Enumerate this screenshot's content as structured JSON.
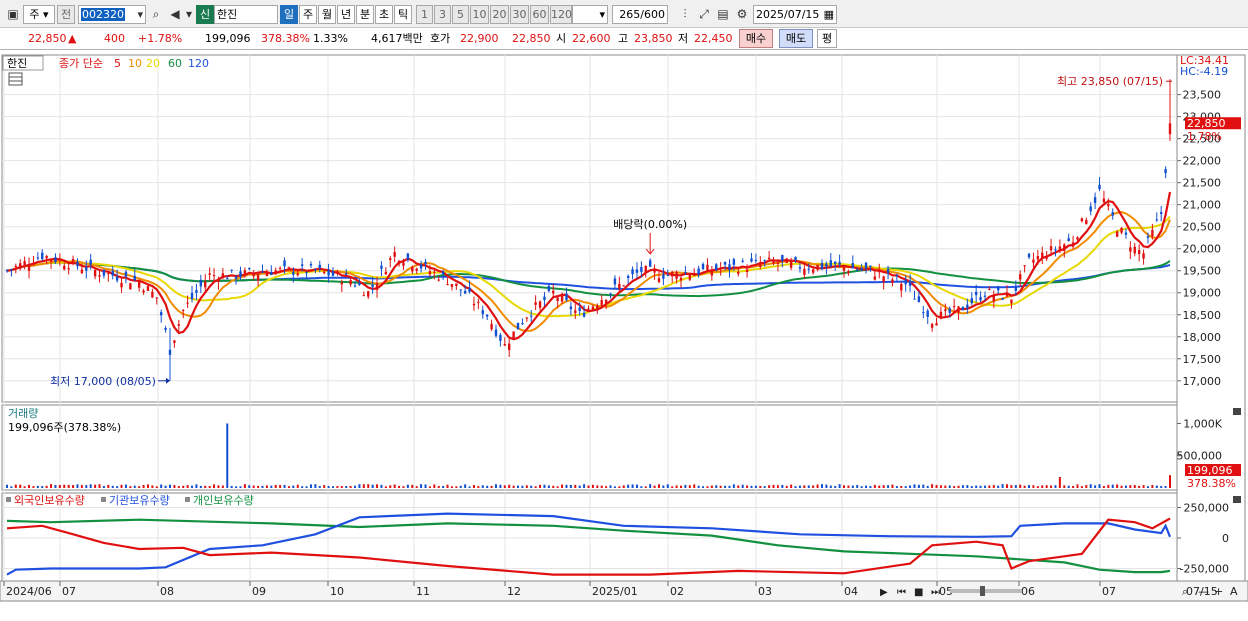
{
  "toolbar": {
    "market": "주",
    "prev": "전",
    "code": "002320",
    "new_badge": "신",
    "name": "한진",
    "periods": [
      "일",
      "주",
      "월",
      "년",
      "분",
      "초",
      "틱"
    ],
    "active_period": "일",
    "intervals": [
      "1",
      "3",
      "5",
      "10",
      "20",
      "30",
      "60",
      "120"
    ],
    "count": "265",
    "count_total": "/600",
    "date": "2025/07/15"
  },
  "quote": {
    "price": "22,850",
    "change": "400",
    "change_pct": "+1.78%",
    "volume": "199,096",
    "volume_ratio": "378.38%",
    "turnover_pct": "1.33%",
    "amount": "4,617백만",
    "label_ask": "호가",
    "ask": "22,900",
    "bid": "22,850",
    "label_open": "시",
    "open": "22,600",
    "label_high": "고",
    "high": "23,850",
    "label_low": "저",
    "low": "22,450",
    "buy_label": "매수",
    "sell_label": "매도",
    "eval_label": "평"
  },
  "price_panel": {
    "stock_tab": "한진",
    "ma_title": "종가 단순",
    "ma_periods": [
      "5",
      "10",
      "20",
      "60",
      "120"
    ],
    "ma_colors": [
      "#e01010",
      "#f08c00",
      "#e8d800",
      "#129040",
      "#2050e0"
    ],
    "lc": "LC:34.41",
    "hc": "HC:-4.19",
    "y_ticks": [
      "23,500",
      "23,000",
      "22,500",
      "22,000",
      "21,500",
      "21,000",
      "20,500",
      "20,000",
      "19,500",
      "19,000",
      "18,500",
      "18,000",
      "17,500",
      "17,000"
    ],
    "last_price": "22,850",
    "last_pct": "1.78%",
    "high_label": "최고 23,850 (07/15)",
    "low_label": "최저 17,000 (08/05)",
    "event_label": "배당락(0.00%)"
  },
  "volume_panel": {
    "title": "거래량",
    "summary": "199,096주(378.38%)",
    "y_ticks": [
      "1,000K",
      "500,000"
    ],
    "last": "199,096",
    "last_pct": "378.38%"
  },
  "holdings_panel": {
    "series": [
      "외국인보유수량",
      "기관보유수량",
      "개인보유수량"
    ],
    "colors": [
      "#e01010",
      "#2050e0",
      "#129040"
    ],
    "y_ticks": [
      "250,000",
      "0",
      "-250,000"
    ]
  },
  "x_axis": {
    "labels": [
      "2024/06",
      "07",
      "08",
      "09",
      "10",
      "11",
      "12",
      "2025/01",
      "02",
      "03",
      "04",
      "05",
      "06",
      "07"
    ],
    "right_label": "07/15"
  },
  "chart_data": {
    "type": "candlestick",
    "x_range": [
      "2024/06",
      "2025/07/15"
    ],
    "ylim": [
      17000,
      23850
    ],
    "high": 23850,
    "low": 17000,
    "last": 22850,
    "moving_averages": [
      "5",
      "10",
      "20",
      "60",
      "120"
    ]
  }
}
